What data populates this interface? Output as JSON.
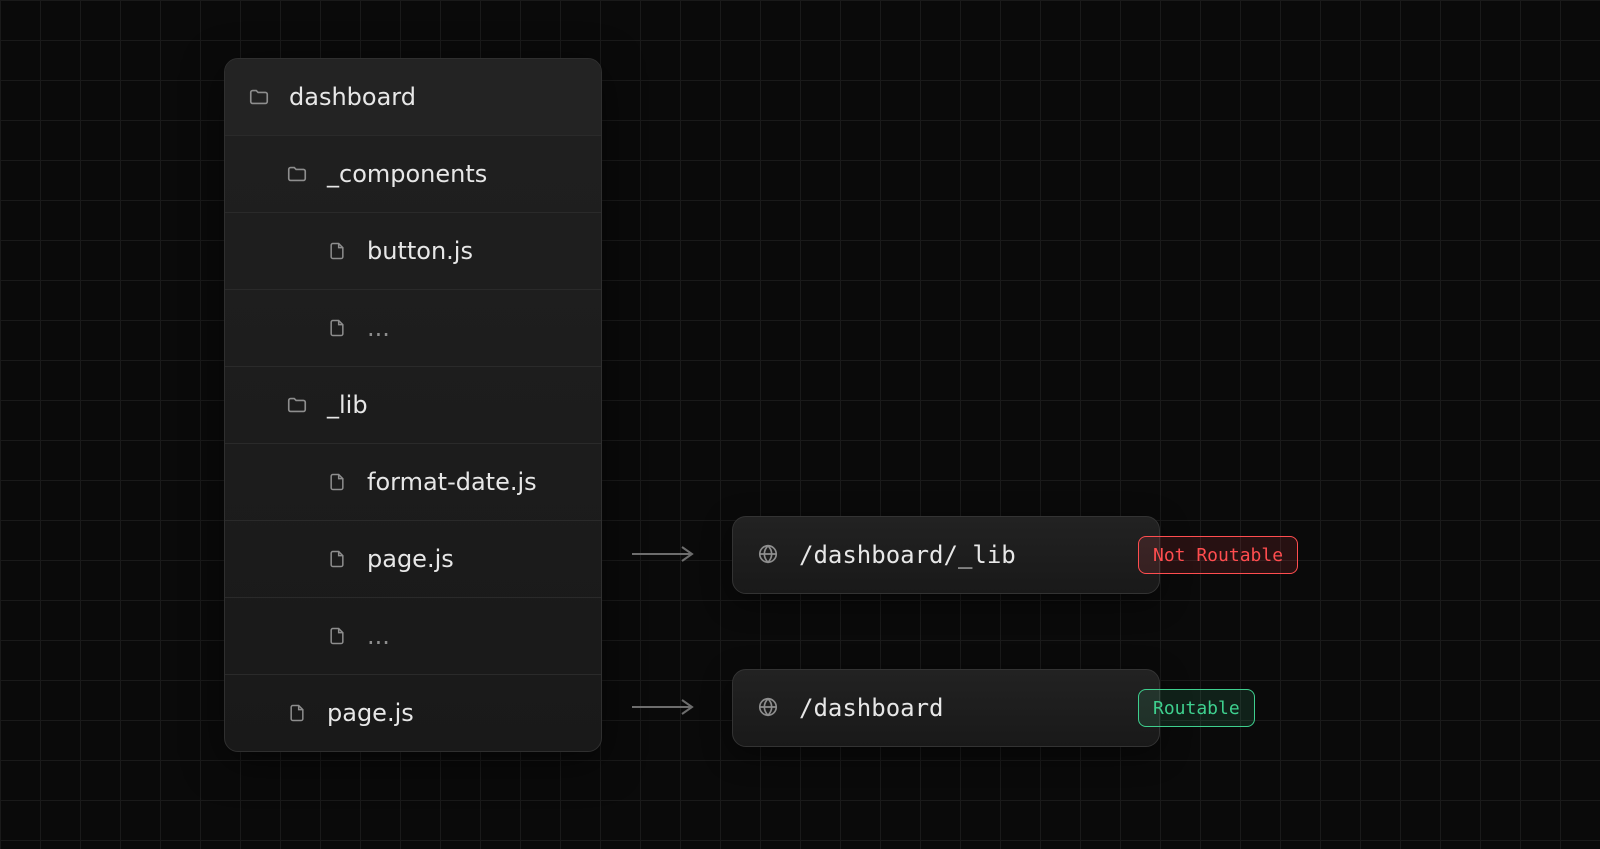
{
  "tree": {
    "root": "dashboard",
    "components_folder": "_components",
    "button_file": "button.js",
    "ellipsis1": "...",
    "lib_folder": "_lib",
    "format_date_file": "format-date.js",
    "lib_page_file": "page.js",
    "ellipsis2": "...",
    "root_page_file": "page.js"
  },
  "routes": {
    "lib_path": "/dashboard/_lib",
    "root_path": "/dashboard"
  },
  "badges": {
    "not_routable": "Not Routable",
    "routable": "Routable"
  }
}
